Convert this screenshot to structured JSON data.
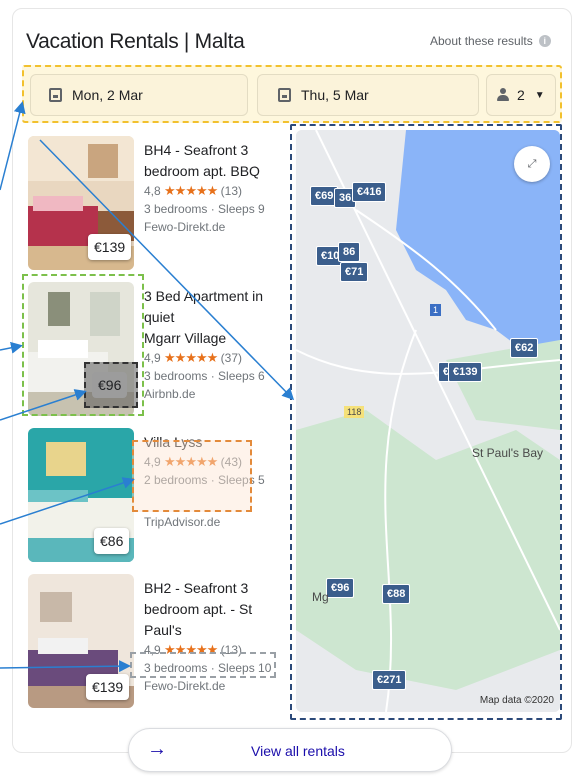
{
  "header": {
    "title": "Vacation Rentals | Malta",
    "about_label": "About these results",
    "info_icon": "i"
  },
  "filters": {
    "checkin": "Mon, 2 Mar",
    "checkout": "Thu, 5 Mar",
    "guests": "2"
  },
  "listings": [
    {
      "title_lines": [
        "BH4 - Seafront 3",
        "bedroom apt. BBQ"
      ],
      "rating": "4,8",
      "stars": "★★★★★",
      "count": "(13)",
      "meta": "3 bedrooms · Sleeps 9",
      "source": "Fewo-Direkt.de",
      "price": "€139"
    },
    {
      "title_lines": [
        "3 Bed Apartment in quiet",
        "Mgarr Village"
      ],
      "rating": "4,9",
      "stars": "★★★★★",
      "count": "(37)",
      "meta": "3 bedrooms · Sleeps 6",
      "source": "Airbnb.de",
      "price": "€96"
    },
    {
      "title_lines": [
        "Villa Lyss"
      ],
      "rating": "4,9",
      "stars": "★★★★★",
      "count": "(43)",
      "meta": "2 bedrooms · Sleeps 5",
      "source": "TripAdvisor.de",
      "price": "€86"
    },
    {
      "title_lines": [
        "BH2 - Seafront 3",
        "bedroom apt. - St Paul's"
      ],
      "rating": "4,9",
      "stars": "★★★★★",
      "count": "(13)",
      "meta": "3 bedrooms · Sleeps 10",
      "source": "Fewo-Direkt.de",
      "price": "€139"
    }
  ],
  "map": {
    "pins": [
      "€69",
      "36",
      "€416",
      "€105",
      "86",
      "€71",
      "€62",
      "€",
      "€139",
      "€96",
      "€88",
      "€271"
    ],
    "labels": {
      "st_pauls_bay": "St Paul's Bay",
      "road_118": "118",
      "road_1": "1",
      "mg": "Mg",
      "attribution": "Map data ©2020"
    },
    "expand_icon": "⤢"
  },
  "footer": {
    "view_all_label": "View all rentals",
    "arrow": "→"
  },
  "colors": {
    "annotation_yellow": "#f2c12e",
    "annotation_blue": "#2c4a7a",
    "annotation_green": "#7cc04b",
    "annotation_black": "#333333",
    "annotation_orange": "#e38a3a",
    "annotation_gray": "#9aa0a6",
    "arrow": "#2a7fd1",
    "star": "#e7711b",
    "pin": "#3b5e8c"
  }
}
